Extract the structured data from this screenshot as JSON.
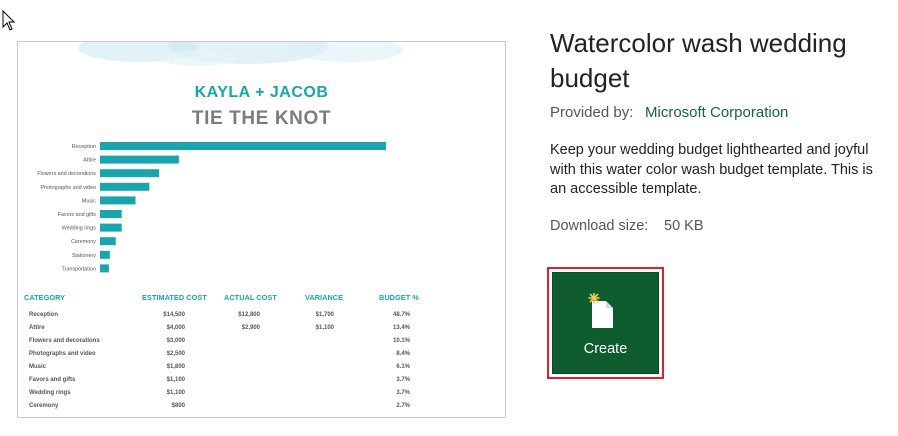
{
  "template": {
    "title": "Watercolor wash wedding budget",
    "provided_by_label": "Provided by:",
    "provider": "Microsoft Corporation",
    "description": "Keep your wedding budget lighthearted and joyful with this water color wash budget template. This is an accessible template.",
    "download_size_label": "Download size:",
    "download_size": "50 KB",
    "create_label": "Create"
  },
  "preview": {
    "couple": "KAYLA + JACOB",
    "headline": "TIE THE KNOT",
    "table_headers": [
      "CATEGORY",
      "ESTIMATED COST",
      "ACTUAL COST",
      "VARIANCE",
      "BUDGET %"
    ],
    "table_rows": [
      {
        "category": "Reception",
        "estimated": "$14,500",
        "actual": "$12,800",
        "variance": "$1,700",
        "budget": "48.7%"
      },
      {
        "category": "Attire",
        "estimated": "$4,000",
        "actual": "$2,900",
        "variance": "$1,100",
        "budget": "13.4%"
      },
      {
        "category": "Flowers and decorations",
        "estimated": "$3,000",
        "actual": "",
        "variance": "",
        "budget": "10.1%"
      },
      {
        "category": "Photographs and video",
        "estimated": "$2,500",
        "actual": "",
        "variance": "",
        "budget": "8.4%"
      },
      {
        "category": "Music",
        "estimated": "$1,800",
        "actual": "",
        "variance": "",
        "budget": "6.1%"
      },
      {
        "category": "Favors and gifts",
        "estimated": "$1,100",
        "actual": "",
        "variance": "",
        "budget": "3.7%"
      },
      {
        "category": "Wedding rings",
        "estimated": "$1,100",
        "actual": "",
        "variance": "",
        "budget": "3.7%"
      },
      {
        "category": "Ceremony",
        "estimated": "$800",
        "actual": "",
        "variance": "",
        "budget": "2.7%"
      }
    ]
  },
  "chart_data": {
    "type": "bar",
    "orientation": "horizontal",
    "categories": [
      "Reception",
      "Attire",
      "Flowers and decorations",
      "Photographs and video",
      "Music",
      "Favors and gifts",
      "Wedding rings",
      "Ceremony",
      "Stationery",
      "Transportation"
    ],
    "values": [
      14500,
      4000,
      3000,
      2500,
      1800,
      1100,
      1100,
      800,
      500,
      450
    ],
    "xlim": [
      0,
      14500
    ],
    "grid": false,
    "color": "#1aa5ae"
  },
  "colors": {
    "accent": "#1aa5ae",
    "create_button": "#0f5c2e",
    "highlight_border": "#e0202a",
    "provider_link": "#16663a"
  }
}
